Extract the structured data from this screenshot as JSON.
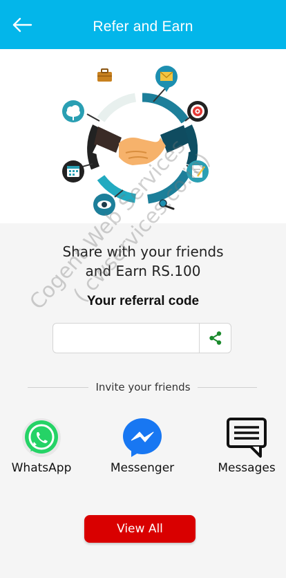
{
  "header": {
    "title": "Refer and Earn",
    "back_icon": "arrow-left-icon",
    "background": "#03b6ea"
  },
  "hero": {
    "illustration": "handshake-icon",
    "icons": [
      "briefcase-icon",
      "mail-icon",
      "target-icon",
      "cloud-icon",
      "calendar-icon",
      "eye-icon",
      "magnifier-icon",
      "notepad-icon"
    ]
  },
  "referral": {
    "share_line1": "Share with your friends",
    "share_line2": "and Earn RS.100",
    "code_title": "Your referral code",
    "code_value": "",
    "share_icon": "share-icon"
  },
  "invite": {
    "label": "Invite your friends",
    "apps": [
      {
        "label": "WhatsApp",
        "icon": "whatsapp-icon",
        "color": "#25d366"
      },
      {
        "label": "Messenger",
        "icon": "messenger-icon",
        "color": "#1877f2"
      },
      {
        "label": "Messages",
        "icon": "messages-icon",
        "color": "#111111"
      }
    ]
  },
  "actions": {
    "view_all_label": "View All",
    "view_all_color": "#d90000"
  },
  "watermark": {
    "line1": "Cogent Web Services",
    "line2": "( cwservices.co.in)"
  }
}
